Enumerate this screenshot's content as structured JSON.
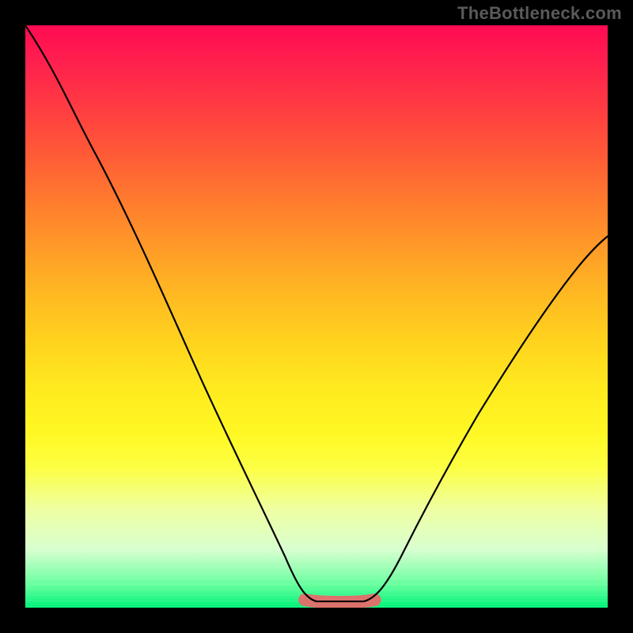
{
  "watermark": "TheBottleneck.com",
  "chart_data": {
    "type": "line",
    "title": "",
    "xlabel": "",
    "ylabel": "",
    "xlim": [
      0,
      100
    ],
    "ylim": [
      0,
      100
    ],
    "grid": false,
    "legend": false,
    "series": [
      {
        "name": "v-curve",
        "x": [
          0,
          5,
          10,
          15,
          20,
          25,
          30,
          35,
          40,
          45,
          48,
          52,
          55,
          58,
          60,
          65,
          70,
          75,
          80,
          85,
          90,
          95,
          100
        ],
        "y": [
          100,
          94,
          87,
          79,
          70,
          60,
          50,
          40,
          29,
          15,
          5,
          1,
          1,
          1,
          3,
          8,
          16,
          25,
          33,
          41,
          49,
          56,
          63
        ]
      }
    ],
    "annotations": [
      {
        "name": "bottom-highlight",
        "x_range": [
          48,
          60
        ],
        "y": 1,
        "color": "#e76a6a"
      }
    ],
    "background_gradient": {
      "top": "#ff0a52",
      "mid": "#ffe91f",
      "bottom": "#00f37a"
    }
  }
}
